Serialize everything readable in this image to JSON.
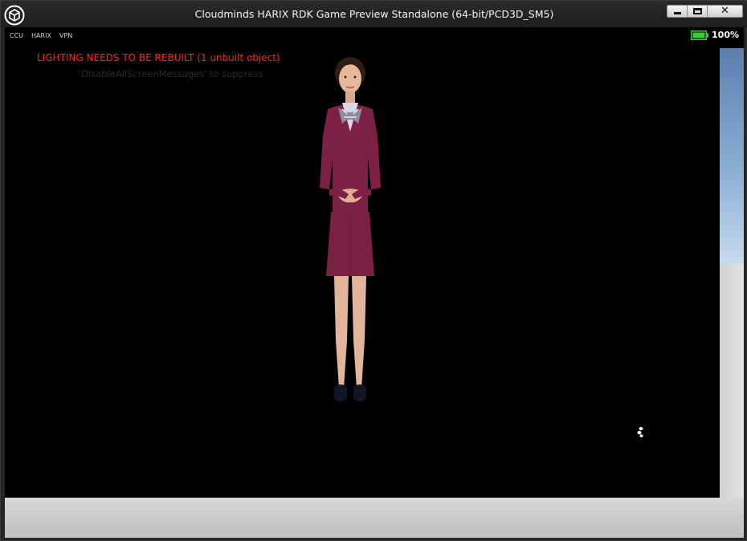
{
  "window": {
    "title": "Cloudminds HARIX RDK Game Preview Standalone (64-bit/PCD3D_SM5)",
    "logo_icon": "unreal-engine-logo-icon",
    "controls": {
      "minimize_icon": "minimize-icon",
      "maximize_icon": "maximize-icon",
      "close_icon": "close-icon",
      "close_glyph": "✕"
    }
  },
  "hud": {
    "tabs": [
      "CCU",
      "HARIX",
      "VPN"
    ],
    "battery": {
      "icon": "battery-icon",
      "level": 100,
      "label": "100%",
      "color": "#3ccb3c"
    }
  },
  "messages": {
    "warning": "LIGHTING NEEDS TO BE REBUILT (1 unbuilt object)",
    "warning_color": "#ff2020",
    "suppress": "'DisableAllScreenMessages' to suppress"
  },
  "scene": {
    "avatar_icon": "digital-human-avatar-icon",
    "cursor_icon": "busy-cursor-icon"
  }
}
